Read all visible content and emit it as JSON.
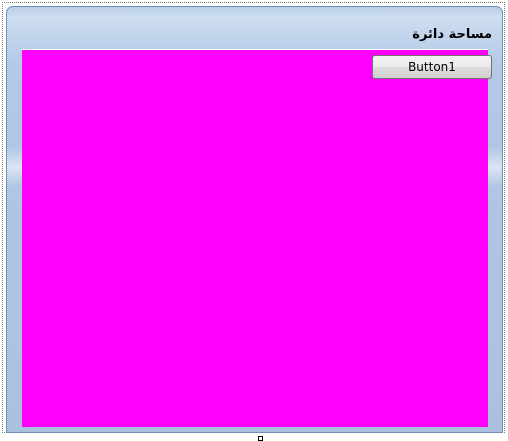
{
  "form": {
    "title": "مساحة دائرة",
    "client_color": "#ff00ff"
  },
  "button1": {
    "label": "Button1"
  }
}
